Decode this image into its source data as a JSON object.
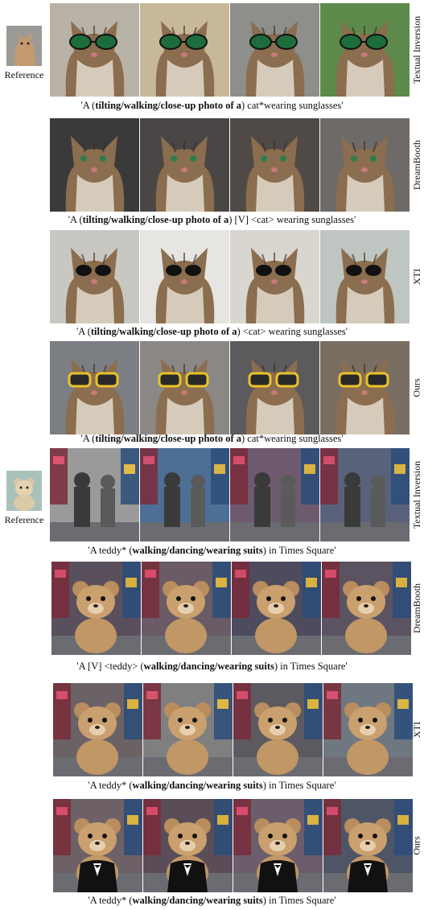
{
  "reference_label": "Reference",
  "sections": [
    {
      "method": "Textual Inversion",
      "ref": "cat",
      "caption": [
        "'A  (",
        "tilting/walking/close-up photo of a",
        ") cat*wearing sunglasses'"
      ],
      "subject": "cat-glasses",
      "tones": [
        "#b9b2a6",
        "#c8b89a",
        "#8e8e8a",
        "#5d8a4a"
      ]
    },
    {
      "method": "DreamBooth",
      "ref": null,
      "caption": [
        "'A (",
        "tilting/walking/close-up photo of a",
        ") [V] <cat> wearing sunglasses'"
      ],
      "subject": "cat",
      "tones": [
        "#3b3a3a",
        "#4a4646",
        "#504a47",
        "#6e6a68"
      ]
    },
    {
      "method": "XTI",
      "ref": null,
      "caption": [
        "'A (",
        "tilting/walking/close-up photo of a",
        ")  <cat> wearing sunglasses'"
      ],
      "subject": "cat-dark-glasses",
      "tones": [
        "#c9c7c2",
        "#e7e5e1",
        "#d9d6d0",
        "#bfc5c0"
      ]
    },
    {
      "method": "Ours",
      "ref": null,
      "caption": [
        "'A  (",
        "tilting/walking/close-up photo of a",
        ") cat*wearing sunglasses'"
      ],
      "subject": "cat-color-glasses",
      "tones": [
        "#7b7f84",
        "#8a8784",
        "#5b5a5c",
        "#7a6e62"
      ]
    },
    {
      "method": "Textual Inversion",
      "ref": "teddy",
      "caption": [
        "'A teddy* (",
        "walking/dancing/wearing suits",
        ") in Times Square'"
      ],
      "subject": "teddy-street",
      "tones": [
        "#9a9a9a",
        "#4d6f96",
        "#6d5a6e",
        "#59627a"
      ]
    },
    {
      "method": "DreamBooth",
      "ref": null,
      "caption": [
        "'A [V] <teddy> (",
        "walking/dancing/wearing suits",
        ") in Times Square'"
      ],
      "subject": "teddy",
      "tones": [
        "#5a4f5c",
        "#6a5b66",
        "#4d4b5d",
        "#5b5361"
      ]
    },
    {
      "method": "XTI",
      "ref": null,
      "caption": [
        "'A  teddy* (",
        "walking/dancing/wearing suits",
        ") in Times Square'"
      ],
      "subject": "teddy",
      "tones": [
        "#6b6266",
        "#7f7f7f",
        "#5c5a60",
        "#6f7780"
      ]
    },
    {
      "method": "Ours",
      "ref": null,
      "caption": [
        "'A teddy* (",
        "walking/dancing/wearing suits",
        ") in Times Square'"
      ],
      "subject": "teddy-suit",
      "tones": [
        "#6d6066",
        "#5a4d58",
        "#6b5d6b",
        "#4d5567"
      ]
    }
  ]
}
